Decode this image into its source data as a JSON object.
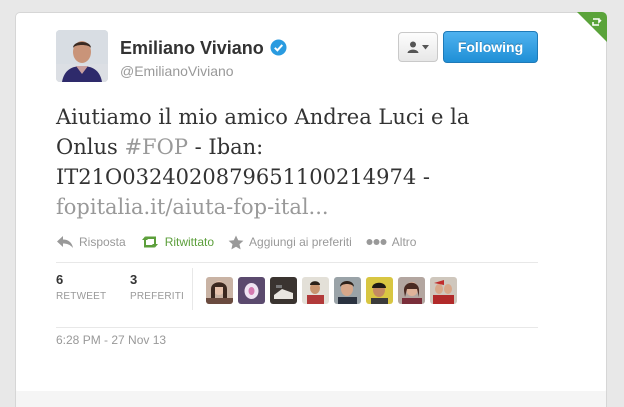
{
  "user": {
    "name": "Emiliano Viviano",
    "handle": "@EmilianoViviano"
  },
  "buttons": {
    "follow_label": "Following"
  },
  "tweet": {
    "text_part1": "Aiutiamo il mio amico Andrea Luci e la Onlus ",
    "hashtag": "#FOP",
    "text_part2": " - Iban: IT21O0324020879651100214974 - ",
    "link": "fopitalia.it/aiuta-fop-ital..."
  },
  "actions": [
    {
      "label": "Risposta",
      "icon": "reply-icon"
    },
    {
      "label": "Ritwittato",
      "icon": "retweet-icon"
    },
    {
      "label": "Aggiungi ai preferiti",
      "icon": "star-icon"
    },
    {
      "label": "Altro",
      "icon": "more-dots-icon"
    }
  ],
  "stats": {
    "retweets": {
      "count": "6",
      "label": "RETWEET"
    },
    "favorites": {
      "count": "3",
      "label": "PREFERITI"
    }
  },
  "timestamp": "6:28 PM - 27 Nov 13",
  "colors": {
    "accent_blue": "#2a9be0",
    "retweet_green": "#5c9f3b",
    "muted_text": "#999999",
    "body_text": "#333333",
    "corner_green": "#5aa33a"
  }
}
